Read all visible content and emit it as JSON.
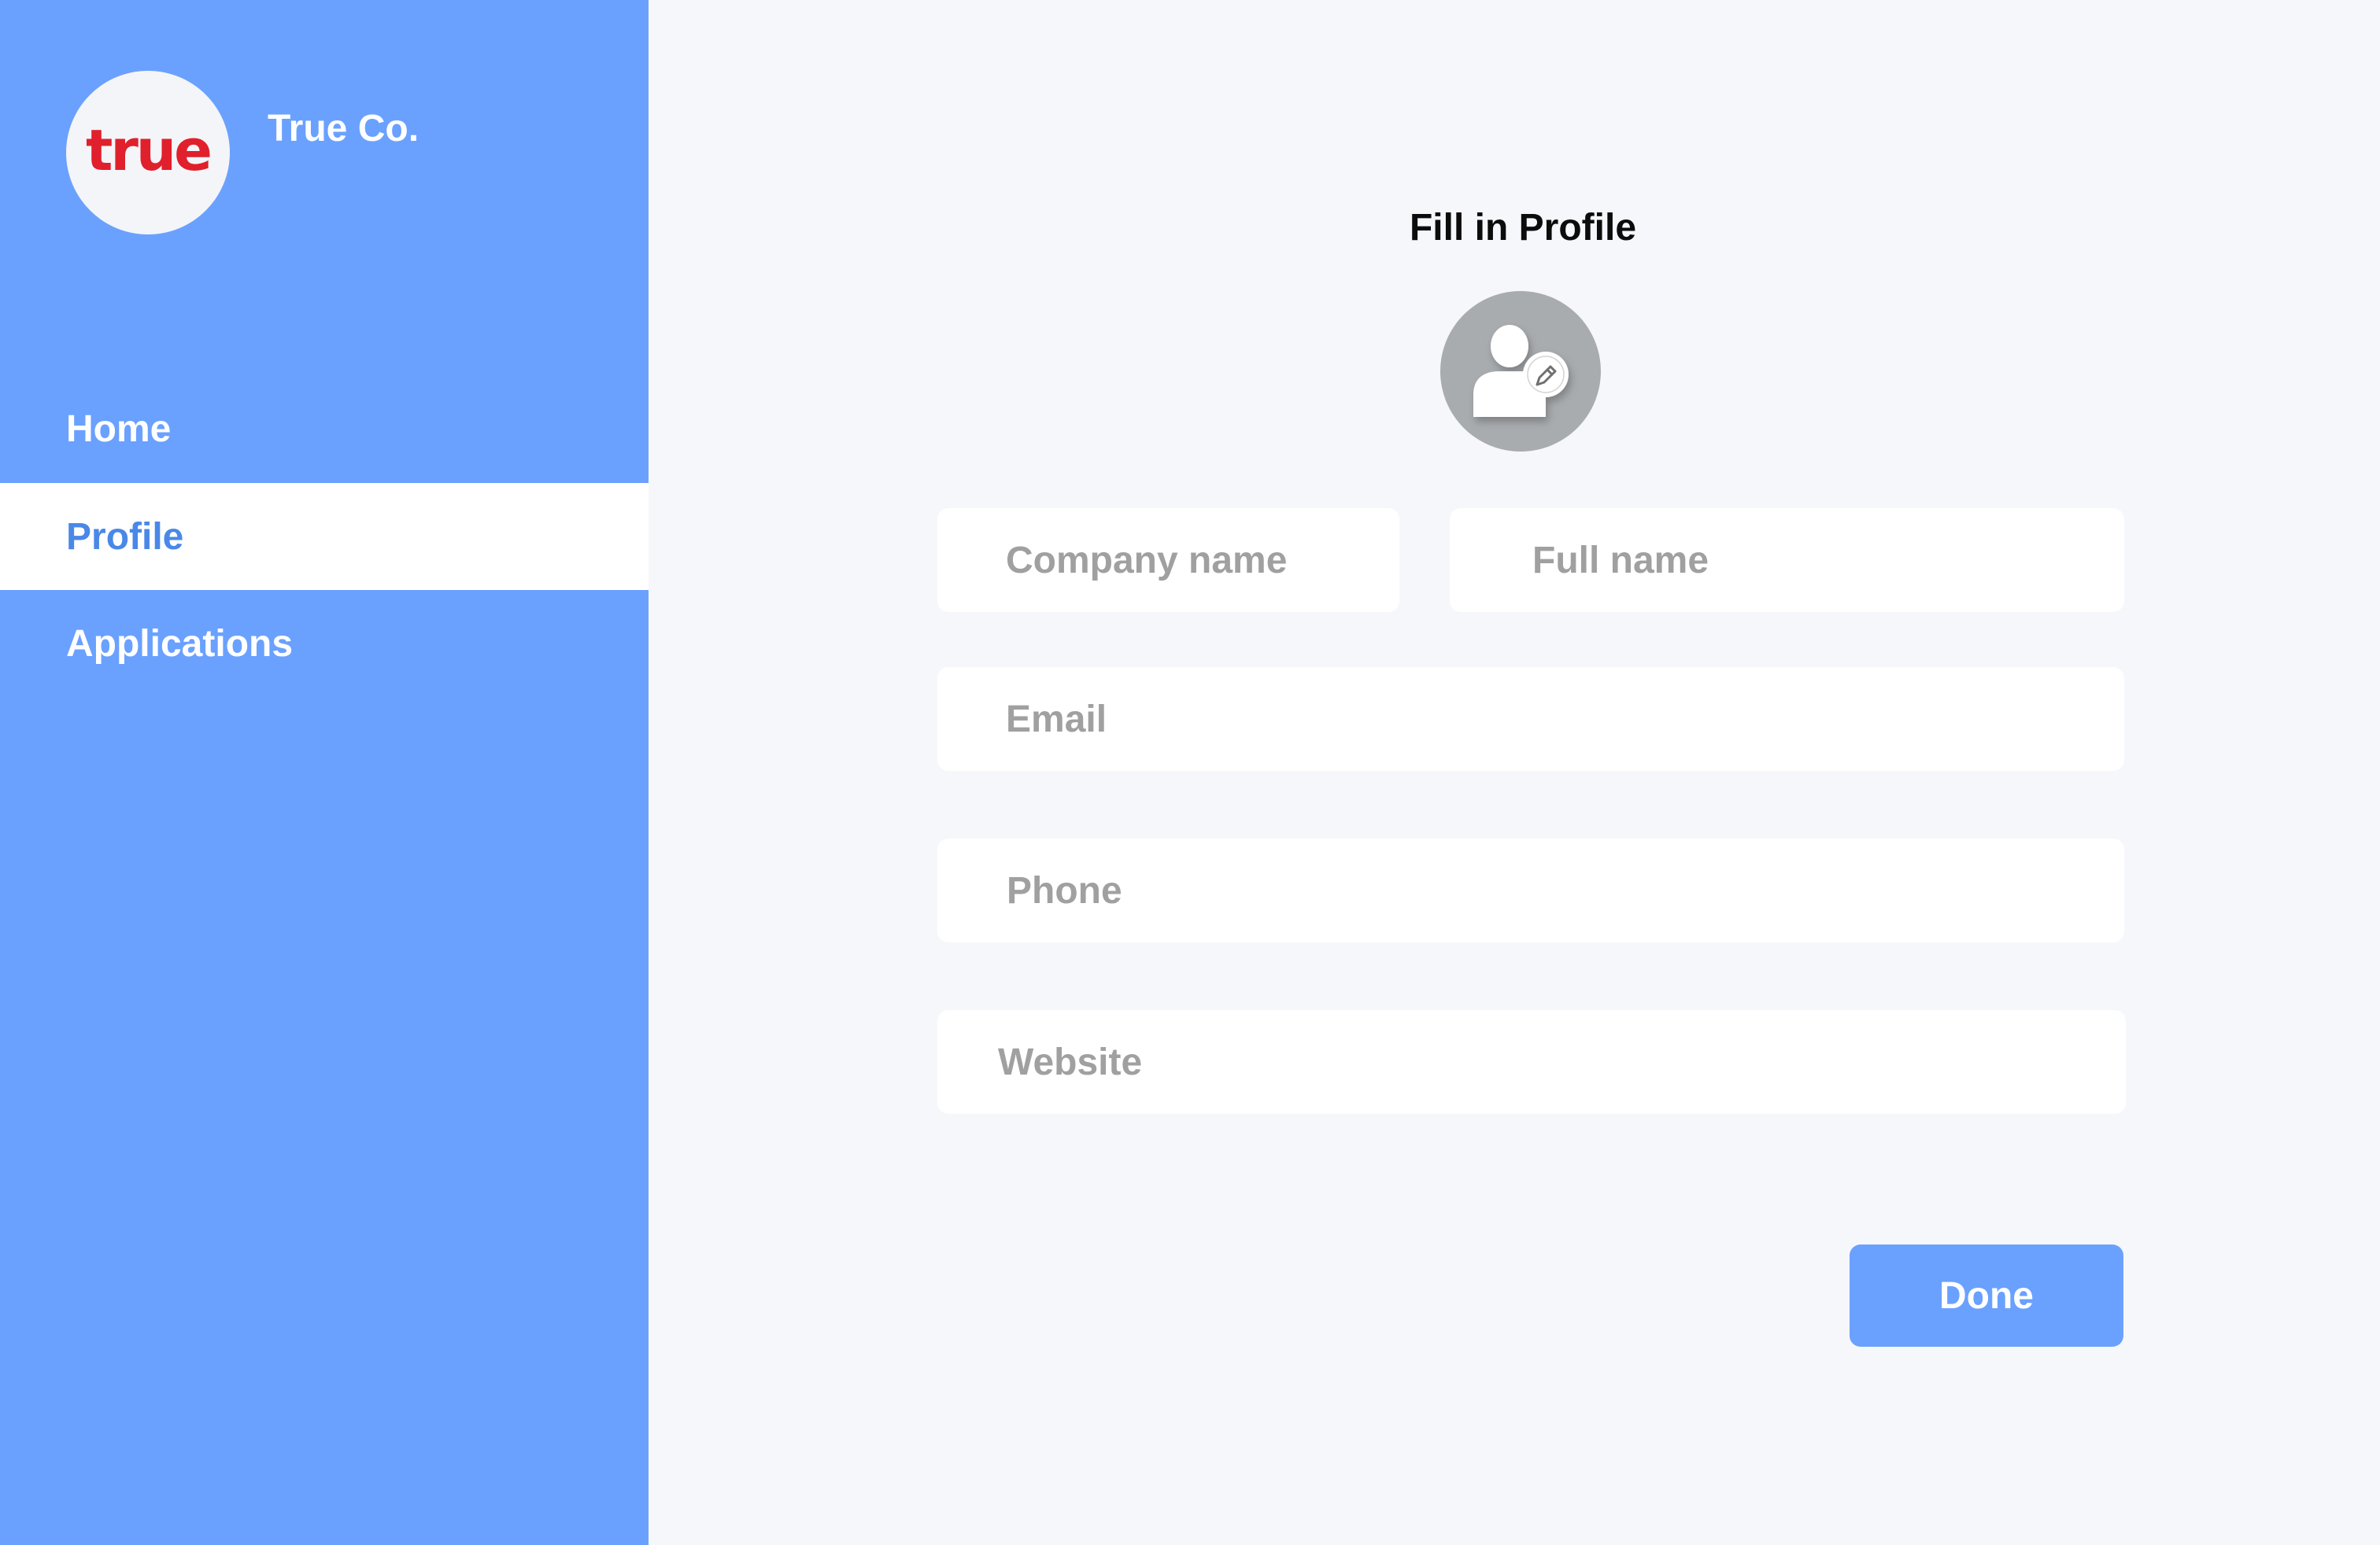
{
  "sidebar": {
    "logo_text": "true",
    "company_name": "True Co.",
    "nav": [
      {
        "label": "Home",
        "active": false
      },
      {
        "label": "Profile",
        "active": true
      },
      {
        "label": "Applications",
        "active": false
      }
    ]
  },
  "main": {
    "title": "Fill in Profile",
    "avatar_icon": "user-edit-icon",
    "fields": {
      "company_name": {
        "placeholder": "Company name",
        "value": ""
      },
      "full_name": {
        "placeholder": "Full name",
        "value": ""
      },
      "email": {
        "placeholder": "Email",
        "value": ""
      },
      "phone": {
        "placeholder": "Phone",
        "value": ""
      },
      "website": {
        "placeholder": "Website",
        "value": ""
      }
    },
    "done_label": "Done"
  },
  "colors": {
    "sidebar_bg": "#6AA1FF",
    "active_nav_text": "#4A88E8",
    "logo_red": "#E0202C",
    "page_bg": "#F6F7FB",
    "avatar_bg": "#A9ACAF"
  }
}
